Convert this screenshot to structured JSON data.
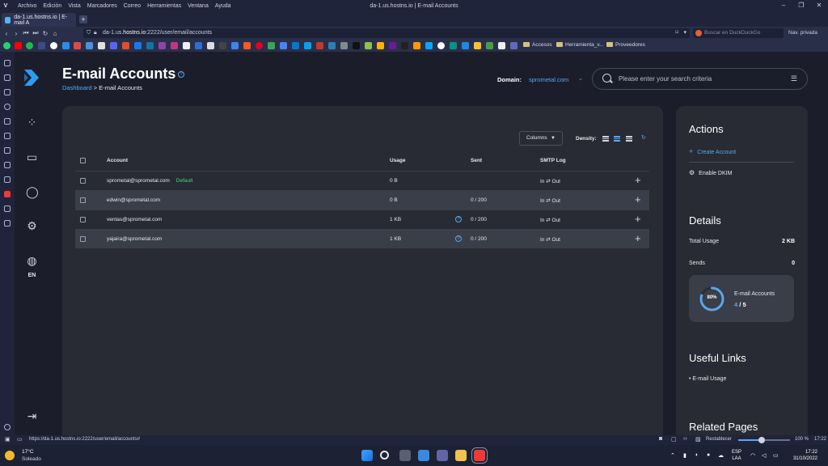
{
  "os_menubar": {
    "menus": [
      "Archivo",
      "Edición",
      "Vista",
      "Marcadores",
      "Correo",
      "Herramientas",
      "Ventana",
      "Ayuda"
    ],
    "window_title": "da-1.us.hostns.io | E-mail Accounts"
  },
  "browser": {
    "tab_title": "da-1.us.hostns.io | E-mail A",
    "url_prefix": "da-1.us.",
    "url_host": "hostns.io",
    "url_path": ":2222/user/email/accounts",
    "search_placeholder": "Buscar en DuckDuckGo",
    "private_label": "Nav. privada",
    "bookmark_folders": [
      "Accesos",
      "Herramienta_v...",
      "Proveedores"
    ],
    "status_url": "https://da-1.us.hostns.io:2222/user/email/accounts#",
    "reset_label": "Restablecer",
    "zoom_percent": "100 %",
    "zoom_fraction": 0.45,
    "status_time": "17:22"
  },
  "sidebar": {
    "language": "EN"
  },
  "page": {
    "title": "E-mail Accounts",
    "breadcrumb_link": "Dashboard",
    "breadcrumb_sep": " > ",
    "breadcrumb_current": "E-mail Accounts",
    "domain_label": "Domain:",
    "domain_value": "sprometal.com",
    "search_placeholder": "Please enter your search criteria"
  },
  "table": {
    "columns_button": "Columns",
    "density_label": "Density:",
    "headers": {
      "account": "Account",
      "usage": "Usage",
      "sent": "Sent",
      "smtp": "SMTP Log"
    },
    "rows": [
      {
        "account": "sprometal@sprometal.com",
        "badge": "Default",
        "usage": "0 B",
        "sent": "",
        "smtp": "In ⇄ Out",
        "info": false
      },
      {
        "account": "edwin@sprometal.com",
        "badge": "",
        "usage": "0 B",
        "sent": "0 / 200",
        "smtp": "In ⇄ Out",
        "info": false
      },
      {
        "account": "ventas@sprometal.com",
        "badge": "",
        "usage": "1 KB",
        "sent": "0 / 200",
        "smtp": "In ⇄ Out",
        "info": true
      },
      {
        "account": "yajaira@sprometal.com",
        "badge": "",
        "usage": "1 KB",
        "sent": "0 / 200",
        "smtp": "In ⇄ Out",
        "info": true
      }
    ]
  },
  "right_panel": {
    "actions_title": "Actions",
    "create_account": "Create Account",
    "enable_dkim": "Enable DKIM",
    "details_title": "Details",
    "total_usage_label": "Total Usage",
    "total_usage_value": "2 KB",
    "sends_label": "Sends",
    "sends_value": "0",
    "quota_percent_label": "80%",
    "quota_fraction": 0.8,
    "quota_label": "E-mail Accounts",
    "quota_used": "4",
    "quota_sep": " / ",
    "quota_total": "5",
    "useful_links_title": "Useful Links",
    "useful_link": "• E-mail Usage",
    "related_pages_title": "Related Pages"
  },
  "taskbar": {
    "temperature": "17°C",
    "weather": "Soleado",
    "lang_top": "ESP",
    "lang_bottom": "LAA",
    "time": "17:22",
    "date": "31/10/2022"
  },
  "colors": {
    "accent": "#5aa7ee",
    "default_badge": "#4cd37b",
    "card": "#282b33",
    "page_bg": "#1b1e2a"
  }
}
